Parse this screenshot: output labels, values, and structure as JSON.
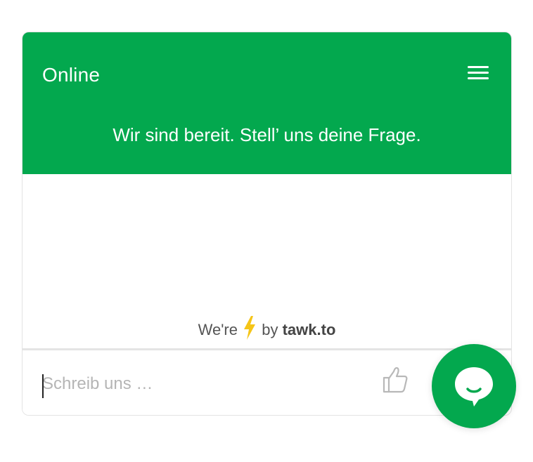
{
  "header": {
    "status": "Online",
    "greeting": "Wir sind bereit. Stell’ uns deine Frage.",
    "menu_icon": "hamburger-menu-icon"
  },
  "branding": {
    "prefix": "We're",
    "bolt_icon": "lightning-bolt-icon",
    "middle": "by",
    "brand": "tawk.to"
  },
  "composer": {
    "placeholder": "Schreib uns …",
    "value": "",
    "like_icon": "thumbs-up-icon"
  },
  "launcher": {
    "icon": "chat-bubble-icon"
  },
  "colors": {
    "accent": "#03a84e",
    "bolt": "#f5c518",
    "header_text": "#ffffff",
    "placeholder": "#b5b5b5"
  }
}
